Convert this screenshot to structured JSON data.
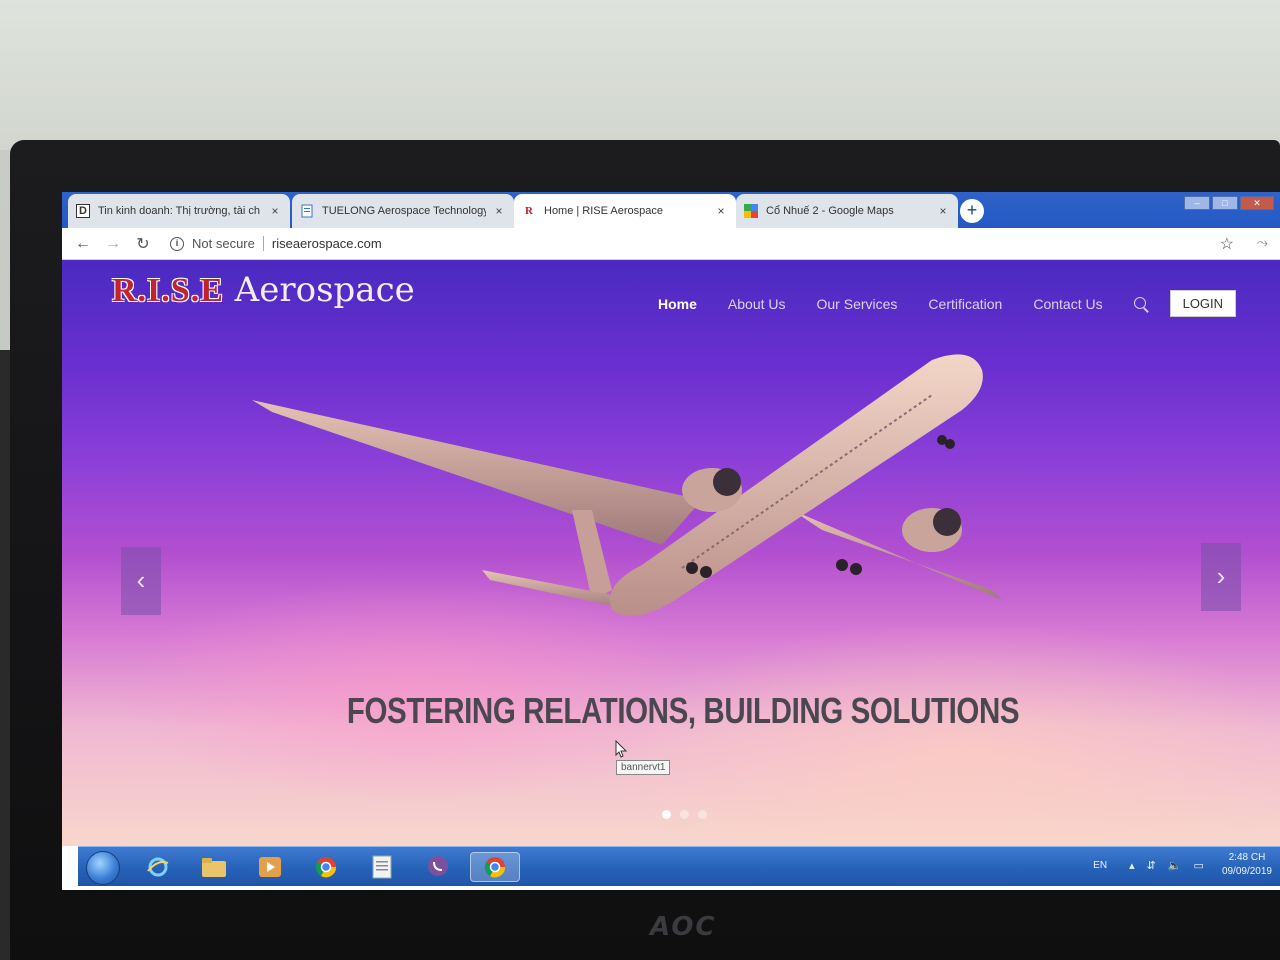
{
  "browser": {
    "tabs": [
      {
        "title": "Tin kinh doanh: Thị trường, tài ch",
        "favicon": "D",
        "active": false
      },
      {
        "title": "TUELONG Aerospace Technology",
        "favicon": "doc",
        "active": false
      },
      {
        "title": "Home | RISE Aerospace",
        "favicon": "R",
        "active": true
      },
      {
        "title": "Cổ Nhuế 2 - Google Maps",
        "favicon": "maps",
        "active": false
      }
    ],
    "close_glyph": "×",
    "newtab_glyph": "+",
    "security_label": "Not secure",
    "url": "riseaerospace.com"
  },
  "site": {
    "brand_rise": "R.I.S.E",
    "brand_rest": " Aerospace",
    "nav": {
      "home": "Home",
      "about": "About Us",
      "services": "Our Services",
      "certification": "Certification",
      "contact": "Contact Us"
    },
    "login_label": "LOGIN",
    "tagline": "FOSTERING RELATIONS, BUILDING SOLUTIONS",
    "tooltip": "bannervt1",
    "prev_glyph": "‹",
    "next_glyph": "›",
    "slide_count": 3,
    "active_slide": 1
  },
  "taskbar": {
    "language": "EN",
    "time": "2:48 CH",
    "date": "09/09/2019"
  },
  "monitor_brand": "AOC",
  "colors": {
    "accent": "#2458c4",
    "brand_red": "#c2242f",
    "hero_top": "#4a2ac0",
    "hero_bottom": "#f8d7cc"
  }
}
